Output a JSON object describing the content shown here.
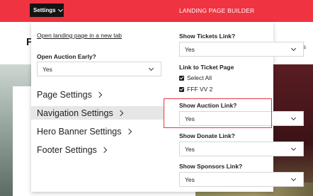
{
  "topbar": {
    "settings_label": "Settings",
    "app_title": "LANDING PAGE BUILDER",
    "accent_color": "#ef3340"
  },
  "background": {
    "heading_fragment": "F",
    "right_fragment": "s"
  },
  "panel": {
    "open_link": "Open landing page in a new tab",
    "open_auction_early": {
      "label": "Open Auction Early?",
      "value": "Yes"
    },
    "nav": [
      {
        "label": "Page Settings",
        "active": false
      },
      {
        "label": "Navigation Settings",
        "active": true
      },
      {
        "label": "Hero Banner Settings",
        "active": false
      },
      {
        "label": "Footer Settings",
        "active": false
      }
    ],
    "show_tickets": {
      "label": "Show Tickets Link?",
      "value": "Yes"
    },
    "link_to_ticket": {
      "label": "Link to Ticket Page",
      "options": [
        {
          "label": "Select All",
          "checked": true
        },
        {
          "label": "FFF VV 2",
          "checked": true
        }
      ]
    },
    "show_auction": {
      "label": "Show Auction Link?",
      "value": "Yes",
      "highlight_color": "#e3383f"
    },
    "show_donate": {
      "label": "Show Donate Link?",
      "value": "Yes"
    },
    "show_sponsors": {
      "label": "Show Sponsors Link?",
      "value": "Yes"
    }
  }
}
